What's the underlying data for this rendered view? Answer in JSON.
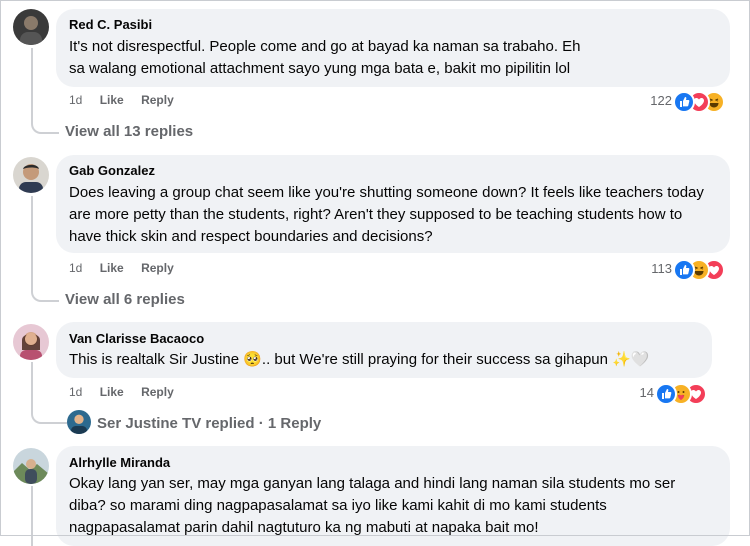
{
  "comments": [
    {
      "author": "Red C. Pasibi",
      "text": "It's not disrespectful. People come and go at bayad ka naman sa trabaho. Eh sa walang emotional attachment sayo yung mga bata e, bakit mo pipilitin lol",
      "time": "1d",
      "like": "Like",
      "reply": "Reply",
      "reaction_count": "122",
      "reactions": [
        "like",
        "love",
        "haha"
      ],
      "view_replies": "View all 13 replies"
    },
    {
      "author": "Gab Gonzalez",
      "text": "Does leaving a group chat seem like you're shutting someone down? It feels like teachers today are more petty than the students, right? Aren't they supposed to be teaching students how to have thick skin and respect boundaries and decisions?",
      "time": "1d",
      "like": "Like",
      "reply": "Reply",
      "reaction_count": "113",
      "reactions": [
        "like",
        "haha",
        "love"
      ],
      "view_replies": "View all 6 replies"
    },
    {
      "author": "Van Clarisse Bacaoco",
      "text": "This is realtalk Sir Justine 🥺.. but We're still praying for their success sa gihapun ✨🤍",
      "time": "1d",
      "like": "Like",
      "reply": "Reply",
      "reaction_count": "14",
      "reactions": [
        "like",
        "care",
        "love"
      ],
      "replied_by": "Ser Justine TV replied · 1 Reply"
    },
    {
      "author": "Alrhylle Miranda",
      "text": "Okay lang yan ser, may mga ganyan lang talaga and hindi lang naman sila students mo ser diba? so marami ding nagpapasalamat sa iyo like kami kahit di mo kami students nagpapasalamat parin dahil nagtuturo ka ng mabuti at napaka bait mo!"
    }
  ],
  "colors": {
    "bubble": "#f0f2f5",
    "muted_text": "#65676b",
    "like_blue": "#1877f2",
    "love_red": "#f33e58",
    "haha_yellow": "#f7b125",
    "thread_line": "#ced0d4"
  }
}
